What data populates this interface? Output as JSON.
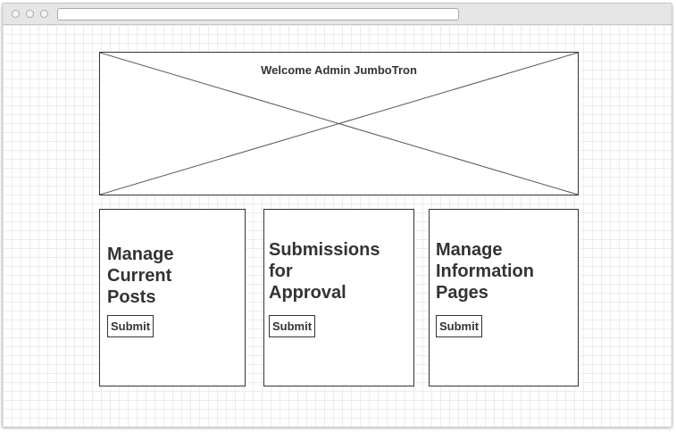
{
  "jumbotron": {
    "title": "Welcome Admin JumboTron"
  },
  "cards": [
    {
      "title_lines": [
        "Manage",
        "Current",
        "Posts"
      ],
      "button_label": "Submit"
    },
    {
      "title_lines": [
        "Submissions",
        "for",
        "Approval"
      ],
      "button_label": "Submit"
    },
    {
      "title_lines": [
        "Manage",
        "Information",
        "Pages"
      ],
      "button_label": "Submit"
    }
  ]
}
